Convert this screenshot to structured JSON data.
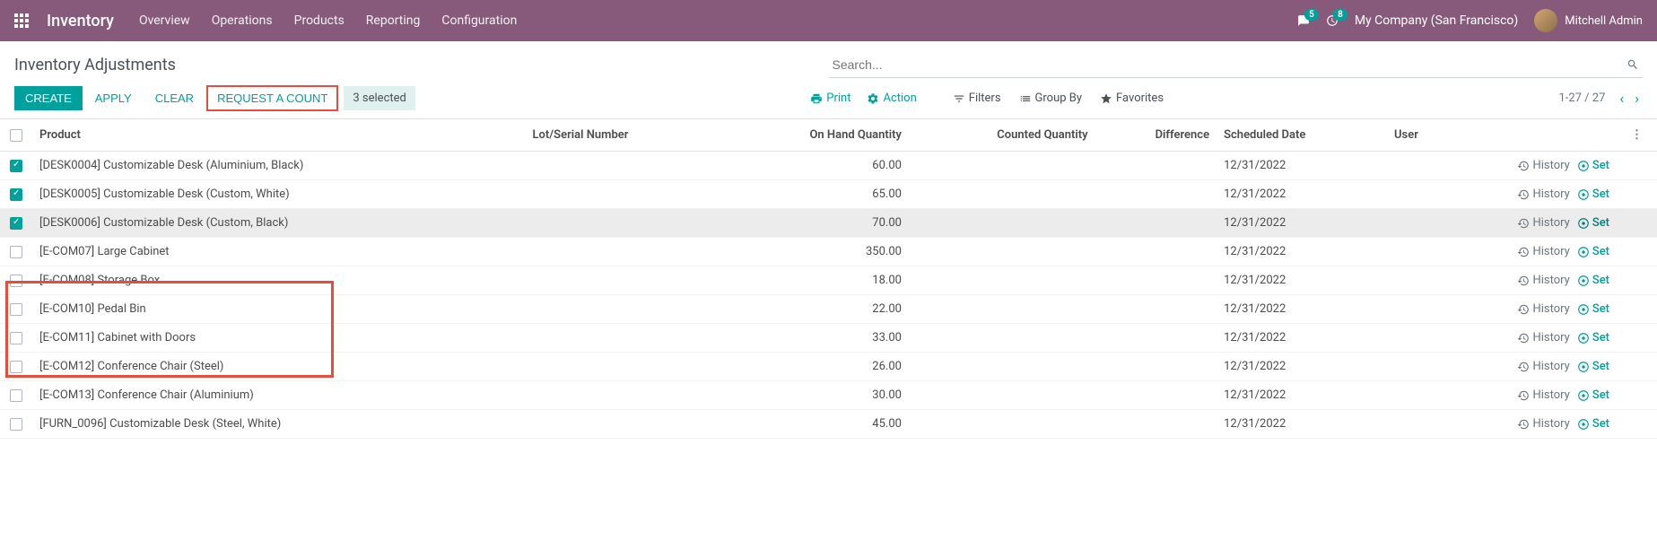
{
  "navbar": {
    "app_name": "Inventory",
    "menu": [
      "Overview",
      "Operations",
      "Products",
      "Reporting",
      "Configuration"
    ],
    "messages_badge": "5",
    "activities_badge": "8",
    "company": "My Company (San Francisco)",
    "user": "Mitchell Admin"
  },
  "control": {
    "title": "Inventory Adjustments",
    "search_placeholder": "Search...",
    "create": "CREATE",
    "apply": "APPLY",
    "clear": "CLEAR",
    "request_count": "REQUEST A COUNT",
    "selected": "3 selected",
    "print": "Print",
    "action": "Action",
    "filters": "Filters",
    "group_by": "Group By",
    "favorites": "Favorites",
    "pager": "1-27 / 27"
  },
  "table": {
    "headers": {
      "product": "Product",
      "lot": "Lot/Serial Number",
      "onhand": "On Hand Quantity",
      "counted": "Counted Quantity",
      "difference": "Difference",
      "scheduled": "Scheduled Date",
      "user": "User"
    },
    "history_label": "History",
    "set_label": "Set",
    "rows": [
      {
        "checked": true,
        "product": "[DESK0004] Customizable Desk (Aluminium, Black)",
        "onhand": "60.00",
        "scheduled": "12/31/2022",
        "hover": false
      },
      {
        "checked": true,
        "product": "[DESK0005] Customizable Desk (Custom, White)",
        "onhand": "65.00",
        "scheduled": "12/31/2022",
        "hover": false
      },
      {
        "checked": true,
        "product": "[DESK0006] Customizable Desk (Custom, Black)",
        "onhand": "70.00",
        "scheduled": "12/31/2022",
        "hover": true
      },
      {
        "checked": false,
        "product": "[E-COM07] Large Cabinet",
        "onhand": "350.00",
        "scheduled": "12/31/2022",
        "hover": false
      },
      {
        "checked": false,
        "product": "[E-COM08] Storage Box",
        "onhand": "18.00",
        "scheduled": "12/31/2022",
        "hover": false
      },
      {
        "checked": false,
        "product": "[E-COM10] Pedal Bin",
        "onhand": "22.00",
        "scheduled": "12/31/2022",
        "hover": false
      },
      {
        "checked": false,
        "product": "[E-COM11] Cabinet with Doors",
        "onhand": "33.00",
        "scheduled": "12/31/2022",
        "hover": false
      },
      {
        "checked": false,
        "product": "[E-COM12] Conference Chair (Steel)",
        "onhand": "26.00",
        "scheduled": "12/31/2022",
        "hover": false
      },
      {
        "checked": false,
        "product": "[E-COM13] Conference Chair (Aluminium)",
        "onhand": "30.00",
        "scheduled": "12/31/2022",
        "hover": false
      },
      {
        "checked": false,
        "product": "[FURN_0096] Customizable Desk (Steel, White)",
        "onhand": "45.00",
        "scheduled": "12/31/2022",
        "hover": false
      }
    ]
  }
}
